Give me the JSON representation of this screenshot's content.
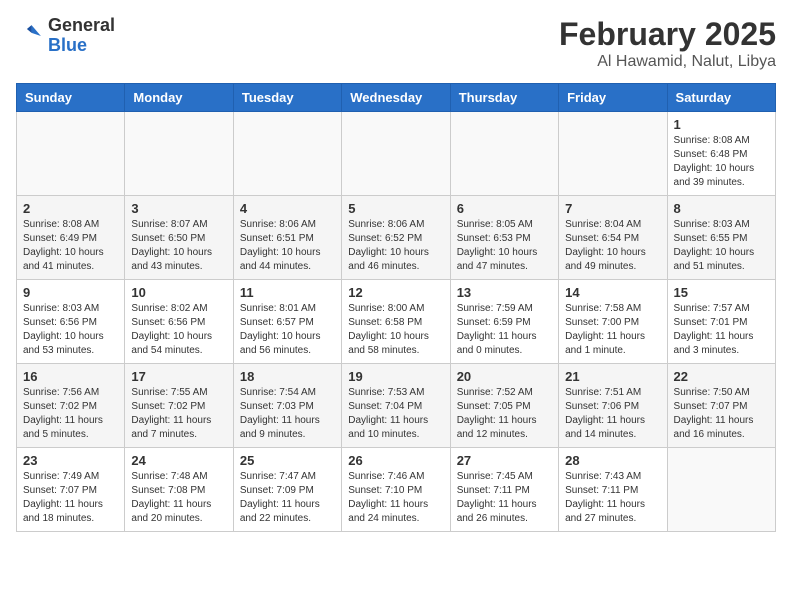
{
  "header": {
    "logo_general": "General",
    "logo_blue": "Blue",
    "month_year": "February 2025",
    "location": "Al Hawamid, Nalut, Libya"
  },
  "days_of_week": [
    "Sunday",
    "Monday",
    "Tuesday",
    "Wednesday",
    "Thursday",
    "Friday",
    "Saturday"
  ],
  "weeks": [
    [
      {
        "num": "",
        "info": ""
      },
      {
        "num": "",
        "info": ""
      },
      {
        "num": "",
        "info": ""
      },
      {
        "num": "",
        "info": ""
      },
      {
        "num": "",
        "info": ""
      },
      {
        "num": "",
        "info": ""
      },
      {
        "num": "1",
        "info": "Sunrise: 8:08 AM\nSunset: 6:48 PM\nDaylight: 10 hours and 39 minutes."
      }
    ],
    [
      {
        "num": "2",
        "info": "Sunrise: 8:08 AM\nSunset: 6:49 PM\nDaylight: 10 hours and 41 minutes."
      },
      {
        "num": "3",
        "info": "Sunrise: 8:07 AM\nSunset: 6:50 PM\nDaylight: 10 hours and 43 minutes."
      },
      {
        "num": "4",
        "info": "Sunrise: 8:06 AM\nSunset: 6:51 PM\nDaylight: 10 hours and 44 minutes."
      },
      {
        "num": "5",
        "info": "Sunrise: 8:06 AM\nSunset: 6:52 PM\nDaylight: 10 hours and 46 minutes."
      },
      {
        "num": "6",
        "info": "Sunrise: 8:05 AM\nSunset: 6:53 PM\nDaylight: 10 hours and 47 minutes."
      },
      {
        "num": "7",
        "info": "Sunrise: 8:04 AM\nSunset: 6:54 PM\nDaylight: 10 hours and 49 minutes."
      },
      {
        "num": "8",
        "info": "Sunrise: 8:03 AM\nSunset: 6:55 PM\nDaylight: 10 hours and 51 minutes."
      }
    ],
    [
      {
        "num": "9",
        "info": "Sunrise: 8:03 AM\nSunset: 6:56 PM\nDaylight: 10 hours and 53 minutes."
      },
      {
        "num": "10",
        "info": "Sunrise: 8:02 AM\nSunset: 6:56 PM\nDaylight: 10 hours and 54 minutes."
      },
      {
        "num": "11",
        "info": "Sunrise: 8:01 AM\nSunset: 6:57 PM\nDaylight: 10 hours and 56 minutes."
      },
      {
        "num": "12",
        "info": "Sunrise: 8:00 AM\nSunset: 6:58 PM\nDaylight: 10 hours and 58 minutes."
      },
      {
        "num": "13",
        "info": "Sunrise: 7:59 AM\nSunset: 6:59 PM\nDaylight: 11 hours and 0 minutes."
      },
      {
        "num": "14",
        "info": "Sunrise: 7:58 AM\nSunset: 7:00 PM\nDaylight: 11 hours and 1 minute."
      },
      {
        "num": "15",
        "info": "Sunrise: 7:57 AM\nSunset: 7:01 PM\nDaylight: 11 hours and 3 minutes."
      }
    ],
    [
      {
        "num": "16",
        "info": "Sunrise: 7:56 AM\nSunset: 7:02 PM\nDaylight: 11 hours and 5 minutes."
      },
      {
        "num": "17",
        "info": "Sunrise: 7:55 AM\nSunset: 7:02 PM\nDaylight: 11 hours and 7 minutes."
      },
      {
        "num": "18",
        "info": "Sunrise: 7:54 AM\nSunset: 7:03 PM\nDaylight: 11 hours and 9 minutes."
      },
      {
        "num": "19",
        "info": "Sunrise: 7:53 AM\nSunset: 7:04 PM\nDaylight: 11 hours and 10 minutes."
      },
      {
        "num": "20",
        "info": "Sunrise: 7:52 AM\nSunset: 7:05 PM\nDaylight: 11 hours and 12 minutes."
      },
      {
        "num": "21",
        "info": "Sunrise: 7:51 AM\nSunset: 7:06 PM\nDaylight: 11 hours and 14 minutes."
      },
      {
        "num": "22",
        "info": "Sunrise: 7:50 AM\nSunset: 7:07 PM\nDaylight: 11 hours and 16 minutes."
      }
    ],
    [
      {
        "num": "23",
        "info": "Sunrise: 7:49 AM\nSunset: 7:07 PM\nDaylight: 11 hours and 18 minutes."
      },
      {
        "num": "24",
        "info": "Sunrise: 7:48 AM\nSunset: 7:08 PM\nDaylight: 11 hours and 20 minutes."
      },
      {
        "num": "25",
        "info": "Sunrise: 7:47 AM\nSunset: 7:09 PM\nDaylight: 11 hours and 22 minutes."
      },
      {
        "num": "26",
        "info": "Sunrise: 7:46 AM\nSunset: 7:10 PM\nDaylight: 11 hours and 24 minutes."
      },
      {
        "num": "27",
        "info": "Sunrise: 7:45 AM\nSunset: 7:11 PM\nDaylight: 11 hours and 26 minutes."
      },
      {
        "num": "28",
        "info": "Sunrise: 7:43 AM\nSunset: 7:11 PM\nDaylight: 11 hours and 27 minutes."
      },
      {
        "num": "",
        "info": ""
      }
    ]
  ]
}
